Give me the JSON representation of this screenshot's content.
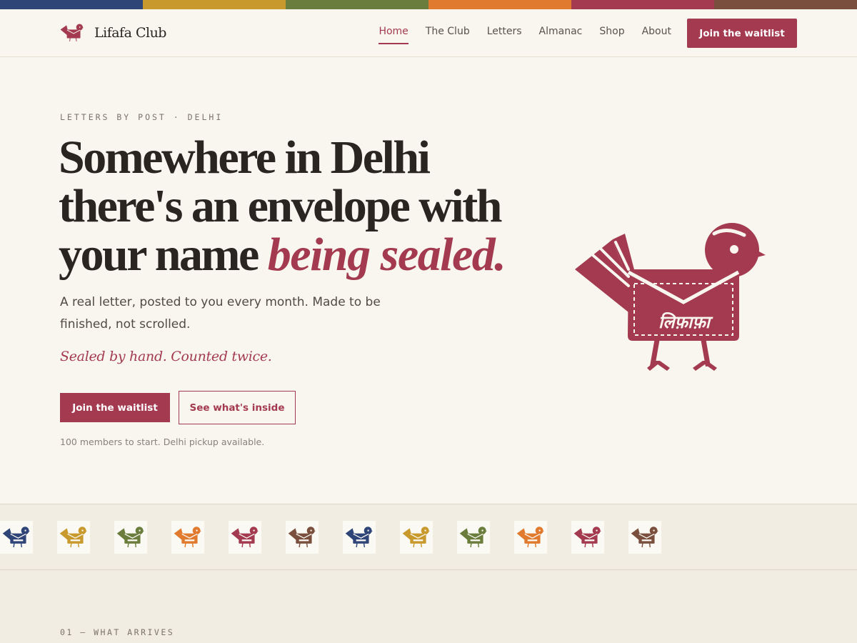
{
  "colors": {
    "accent": "#a33a4f",
    "background": "#f9f6f0",
    "band": "#f2ede3",
    "stripe": [
      "#2f4578",
      "#c89a2e",
      "#6a7d3c",
      "#e07a2e",
      "#a33a4f",
      "#7a4f3e"
    ]
  },
  "brand": {
    "name": "Lifafa Club",
    "logo_icon": "bird-envelope-icon"
  },
  "nav": {
    "items": [
      {
        "label": "Home",
        "active": true
      },
      {
        "label": "The Club",
        "active": false
      },
      {
        "label": "Letters",
        "active": false
      },
      {
        "label": "Almanac",
        "active": false
      },
      {
        "label": "Shop",
        "active": false
      },
      {
        "label": "About",
        "active": false
      }
    ],
    "cta": "Join the waitlist"
  },
  "hero": {
    "eyebrow": "LETTERS BY POST · DELHI",
    "headline_line1": "Somewhere in Delhi",
    "headline_line2": "there's an envelope with",
    "headline_line3": "your name ",
    "headline_emphasis": "being sealed.",
    "subtitle": "A real letter, posted to you every month. Made to be finished, not scrolled.",
    "tagline": "Sealed by hand. Counted twice.",
    "primary_cta": "Join the waitlist",
    "secondary_cta": "See what's inside",
    "footnote": "100 members to start. Delhi pickup available.",
    "illustration_label": "लिफ़ाफ़ा"
  },
  "band": {
    "icon": "bird-envelope-icon",
    "tile_colors": [
      "#2f4578",
      "#c89a2e",
      "#6a7d3c",
      "#e07a2e",
      "#a33a4f",
      "#7a4f3e",
      "#2f4578",
      "#c89a2e",
      "#6a7d3c",
      "#e07a2e",
      "#a33a4f",
      "#7a4f3e"
    ]
  },
  "section": {
    "label": "01 — WHAT ARRIVES"
  }
}
